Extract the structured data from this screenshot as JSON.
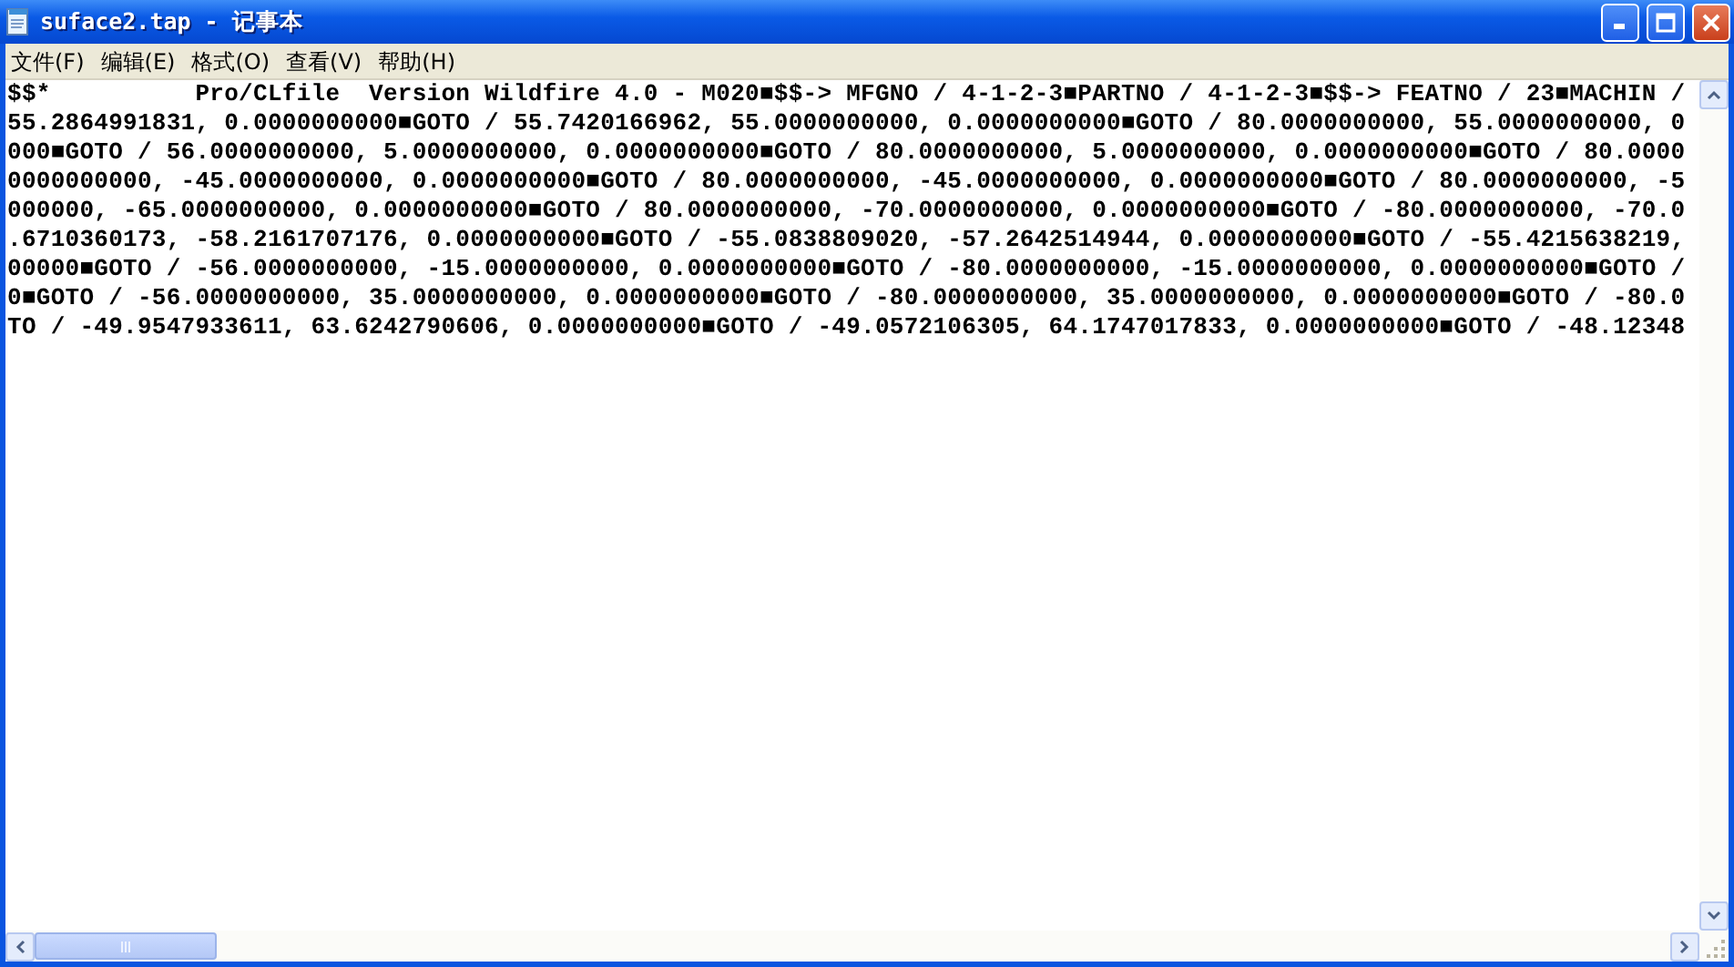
{
  "window": {
    "title": "suface2.tap - 记事本"
  },
  "menu": [
    {
      "label": "文件(F)"
    },
    {
      "label": "编辑(E)"
    },
    {
      "label": "格式(O)"
    },
    {
      "label": "查看(V)"
    },
    {
      "label": "帮助(H)"
    }
  ],
  "editor": {
    "lines": [
      "$$*          Pro/CLfile  Version Wildfire 4.0 - M020■$$-> MFGNO / 4-1-2-3■PARTNO / 4-1-2-3■$$-> FEATNO / 23■MACHIN /",
      "55.2864991831, 0.0000000000■GOTO / 55.7420166962, 55.0000000000, 0.0000000000■GOTO / 80.0000000000, 55.0000000000, 0",
      "000■GOTO / 56.0000000000, 5.0000000000, 0.0000000000■GOTO / 80.0000000000, 5.0000000000, 0.0000000000■GOTO / 80.0000",
      "0000000000, -45.0000000000, 0.0000000000■GOTO / 80.0000000000, -45.0000000000, 0.0000000000■GOTO / 80.0000000000, -5",
      "000000, -65.0000000000, 0.0000000000■GOTO / 80.0000000000, -70.0000000000, 0.0000000000■GOTO / -80.0000000000, -70.0",
      ".6710360173, -58.2161707176, 0.0000000000■GOTO / -55.0838809020, -57.2642514944, 0.0000000000■GOTO / -55.4215638219,",
      "00000■GOTO / -56.0000000000, -15.0000000000, 0.0000000000■GOTO / -80.0000000000, -15.0000000000, 0.0000000000■GOTO /",
      "0■GOTO / -56.0000000000, 35.0000000000, 0.0000000000■GOTO / -80.0000000000, 35.0000000000, 0.0000000000■GOTO / -80.0",
      "TO / -49.9547933611, 63.6242790606, 0.0000000000■GOTO / -49.0572106305, 64.1747017833, 0.0000000000■GOTO / -48.12348"
    ]
  }
}
